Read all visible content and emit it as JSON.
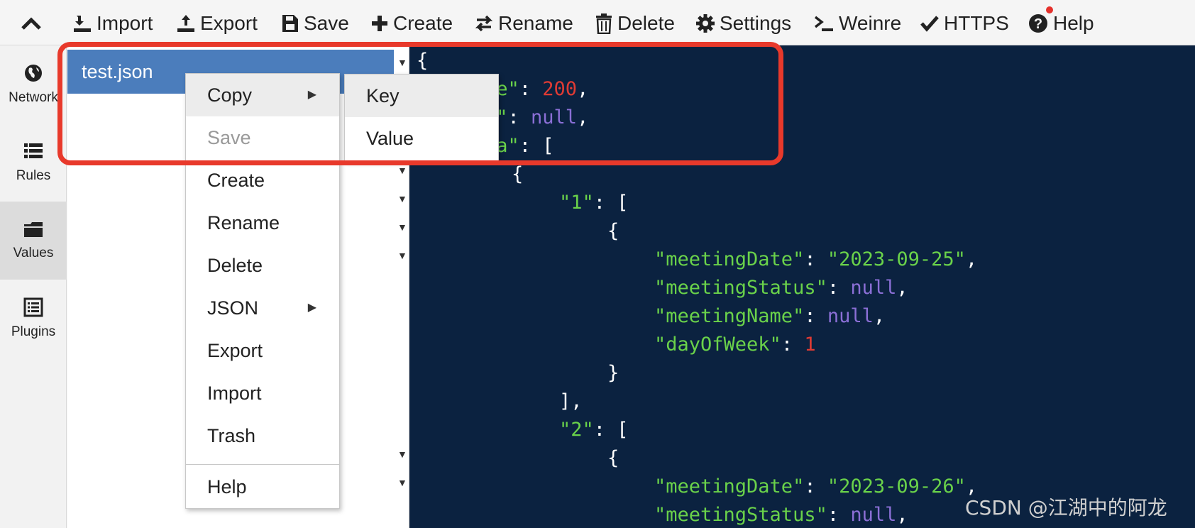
{
  "toolbar": {
    "items": [
      {
        "label": "Import",
        "icon": "import-icon"
      },
      {
        "label": "Export",
        "icon": "export-icon"
      },
      {
        "label": "Save",
        "icon": "save-icon"
      },
      {
        "label": "Create",
        "icon": "plus-icon"
      },
      {
        "label": "Rename",
        "icon": "swap-arrows-icon"
      },
      {
        "label": "Delete",
        "icon": "trash-icon"
      },
      {
        "label": "Settings",
        "icon": "gear-icon"
      },
      {
        "label": "Weinre",
        "icon": "terminal-icon"
      },
      {
        "label": "HTTPS",
        "icon": "checkmark-icon"
      },
      {
        "label": "Help",
        "icon": "question-circle-icon"
      }
    ],
    "notification_color": "#e5312c"
  },
  "sidebar": {
    "items": [
      {
        "label": "Network",
        "icon": "globe-icon"
      },
      {
        "label": "Rules",
        "icon": "list-icon"
      },
      {
        "label": "Values",
        "icon": "folder-icon",
        "active": true
      },
      {
        "label": "Plugins",
        "icon": "plugin-list-icon"
      }
    ]
  },
  "filelist": {
    "selected_file": "test.json",
    "selected_color": "#4b7dbc"
  },
  "editor": {
    "background": "#0b2240",
    "lines": {
      "l1": "{",
      "l2a": "de\"",
      "l2b": ": ",
      "l2c": "200",
      "l2d": ",",
      "l3a": "g\"",
      "l3b": ": ",
      "l3c": "null",
      "l3d": ",",
      "l4a": "ta\"",
      "l4b": ": [",
      "l5": "{",
      "l6a": "\"1\"",
      "l6b": ": [",
      "l7": "{",
      "l8a": "\"meetingDate\"",
      "l8b": ": ",
      "l8c": "\"2023-09-25\"",
      "l8d": ",",
      "l9a": "\"meetingStatus\"",
      "l9b": ": ",
      "l9c": "null",
      "l9d": ",",
      "l10a": "\"meetingName\"",
      "l10b": ": ",
      "l10c": "null",
      "l10d": ",",
      "l11a": "\"dayOfWeek\"",
      "l11b": ": ",
      "l11c": "1",
      "l12": "}",
      "l13": "],",
      "l14a": "\"2\"",
      "l14b": ": [",
      "l15": "{",
      "l16a": "\"meetingDate\"",
      "l16b": ": ",
      "l16c": "\"2023-09-26\"",
      "l16d": ",",
      "l17a": "\"meetingStatus\"",
      "l17b": ": ",
      "l17c": "null",
      "l17d": ","
    }
  },
  "context_menu": {
    "items": [
      "Copy",
      "Save",
      "Create",
      "Rename",
      "Delete",
      "JSON",
      "Export",
      "Import",
      "Trash",
      "Help"
    ]
  },
  "sub_menu": {
    "items": [
      "Key",
      "Value"
    ]
  },
  "highlight_color": "#e8392b",
  "watermark": "CSDN @江湖中的阿龙"
}
